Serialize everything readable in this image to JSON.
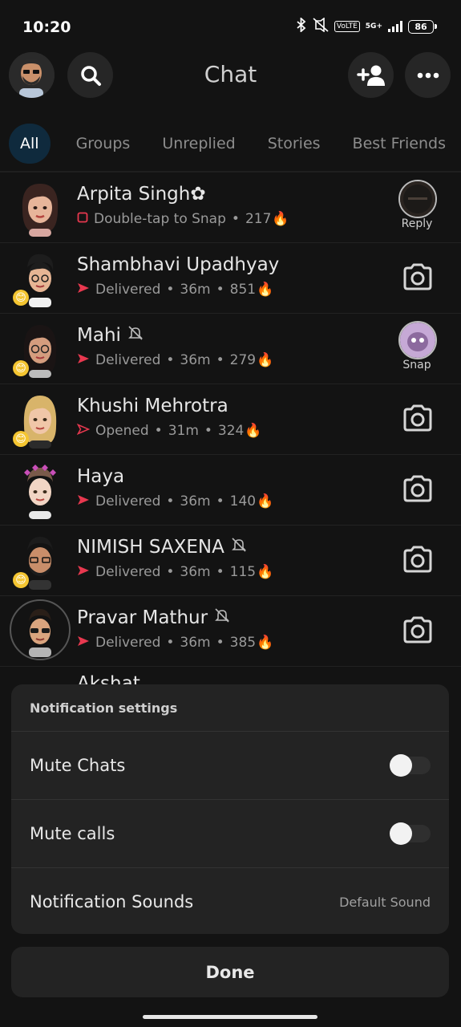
{
  "status_bar": {
    "time": "10:20",
    "network": "5G+",
    "volte": "VoLTE",
    "battery": "86"
  },
  "header": {
    "title": "Chat"
  },
  "tabs": [
    {
      "label": "All",
      "active": true
    },
    {
      "label": "Groups",
      "active": false
    },
    {
      "label": "Unreplied",
      "active": false
    },
    {
      "label": "Stories",
      "active": false
    },
    {
      "label": "Best Friends",
      "active": false
    }
  ],
  "chats": [
    {
      "name": "Arpita Singh✿",
      "status": "Double-tap to Snap",
      "time": "",
      "streak": "217",
      "status_icon": "empty-square-icon",
      "right": "thumbnail",
      "right_label": "Reply",
      "muted": false,
      "emoji": ""
    },
    {
      "name": "Shambhavi Upadhyay",
      "status": "Delivered",
      "time": "36m",
      "streak": "851",
      "status_icon": "filled-arrow-icon",
      "right": "camera",
      "right_label": "",
      "muted": false,
      "emoji": "😊"
    },
    {
      "name": "Mahi",
      "status": "Delivered",
      "time": "36m",
      "streak": "279",
      "status_icon": "filled-arrow-icon",
      "right": "thumbnail",
      "right_label": "Snap",
      "muted": true,
      "emoji": "😊"
    },
    {
      "name": "Khushi Mehrotra",
      "status": "Opened",
      "time": "31m",
      "streak": "324",
      "status_icon": "outline-arrow-icon",
      "right": "camera",
      "right_label": "",
      "muted": false,
      "emoji": "😊"
    },
    {
      "name": "Haya",
      "status": "Delivered",
      "time": "36m",
      "streak": "140",
      "status_icon": "filled-arrow-icon",
      "right": "camera",
      "right_label": "",
      "muted": false,
      "emoji": ""
    },
    {
      "name": "NIMISH SAXENA",
      "status": "Delivered",
      "time": "36m",
      "streak": "115",
      "status_icon": "filled-arrow-icon",
      "right": "camera",
      "right_label": "",
      "muted": true,
      "emoji": "😊"
    },
    {
      "name": "Pravar Mathur",
      "status": "Delivered",
      "time": "36m",
      "streak": "385",
      "status_icon": "filled-arrow-icon",
      "right": "camera",
      "right_label": "",
      "muted": true,
      "emoji": ""
    }
  ],
  "partial_chat": {
    "name": "Akshat"
  },
  "notification_sheet": {
    "title": "Notification settings",
    "mute_chats_label": "Mute Chats",
    "mute_chats_on": false,
    "mute_calls_label": "Mute calls",
    "mute_calls_on": false,
    "sounds_label": "Notification Sounds",
    "sounds_value": "Default Sound"
  },
  "done_label": "Done",
  "colors": {
    "background": "#131313",
    "active_tab_bg": "#0f2a3d",
    "delivered_red": "#e8384f",
    "sheet_bg": "#232323"
  }
}
